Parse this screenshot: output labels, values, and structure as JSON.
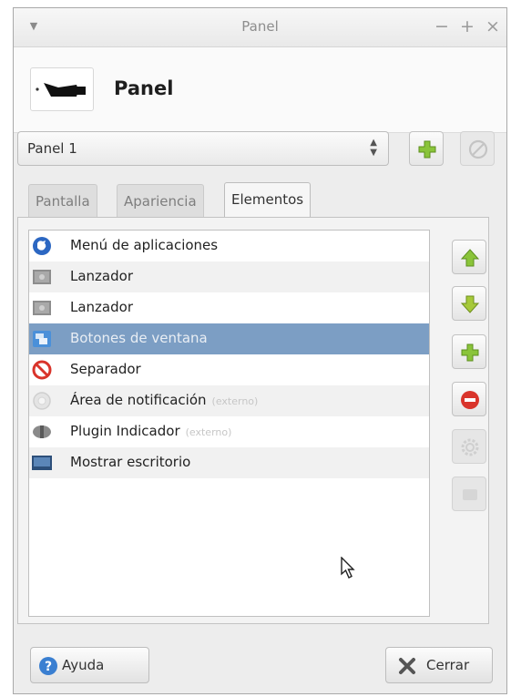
{
  "window": {
    "title": "Panel",
    "buttons": {
      "minimize": "−",
      "maximize": "+",
      "close": "×"
    }
  },
  "header": {
    "title": "Panel",
    "icon": "panel-icon"
  },
  "panel_selector": {
    "value": "Panel 1",
    "add_icon": "add-icon",
    "remove_icon": "remove-icon"
  },
  "tabs": [
    {
      "label": "Pantalla",
      "active": false
    },
    {
      "label": "Apariencia",
      "active": false
    },
    {
      "label": "Elementos",
      "active": true
    }
  ],
  "items": [
    {
      "label": "Menú de aplicaciones",
      "extra": "",
      "icon": "app-menu-icon",
      "selected": false
    },
    {
      "label": "Lanzador",
      "extra": "",
      "icon": "launcher-icon",
      "selected": false
    },
    {
      "label": "Lanzador",
      "extra": "",
      "icon": "launcher-icon",
      "selected": false
    },
    {
      "label": "Botones de ventana",
      "extra": "",
      "icon": "window-buttons-icon",
      "selected": true
    },
    {
      "label": "Separador",
      "extra": "",
      "icon": "separator-icon",
      "selected": false
    },
    {
      "label": "Área de notificación",
      "extra": "(externo)",
      "icon": "notification-area-icon",
      "selected": false
    },
    {
      "label": "Plugin Indicador",
      "extra": "(externo)",
      "icon": "indicator-plugin-icon",
      "selected": false
    },
    {
      "label": "Mostrar escritorio",
      "extra": "",
      "icon": "show-desktop-icon",
      "selected": false
    }
  ],
  "side_buttons": [
    {
      "name": "move-up",
      "icon": "arrow-up-icon",
      "enabled": true
    },
    {
      "name": "move-down",
      "icon": "arrow-down-icon",
      "enabled": true
    },
    {
      "name": "add-item",
      "icon": "add-icon",
      "enabled": true
    },
    {
      "name": "remove-item",
      "icon": "remove-icon",
      "enabled": true
    },
    {
      "name": "item-settings",
      "icon": "gear-icon",
      "enabled": false
    },
    {
      "name": "item-about",
      "icon": "info-icon",
      "enabled": false
    }
  ],
  "footer": {
    "help_label": "Ayuda",
    "close_label": "Cerrar"
  },
  "colors": {
    "selection": "#7c9ec4",
    "add_green": "#8ac43a",
    "remove_red": "#d9342b",
    "help_blue": "#3a7fd1"
  }
}
